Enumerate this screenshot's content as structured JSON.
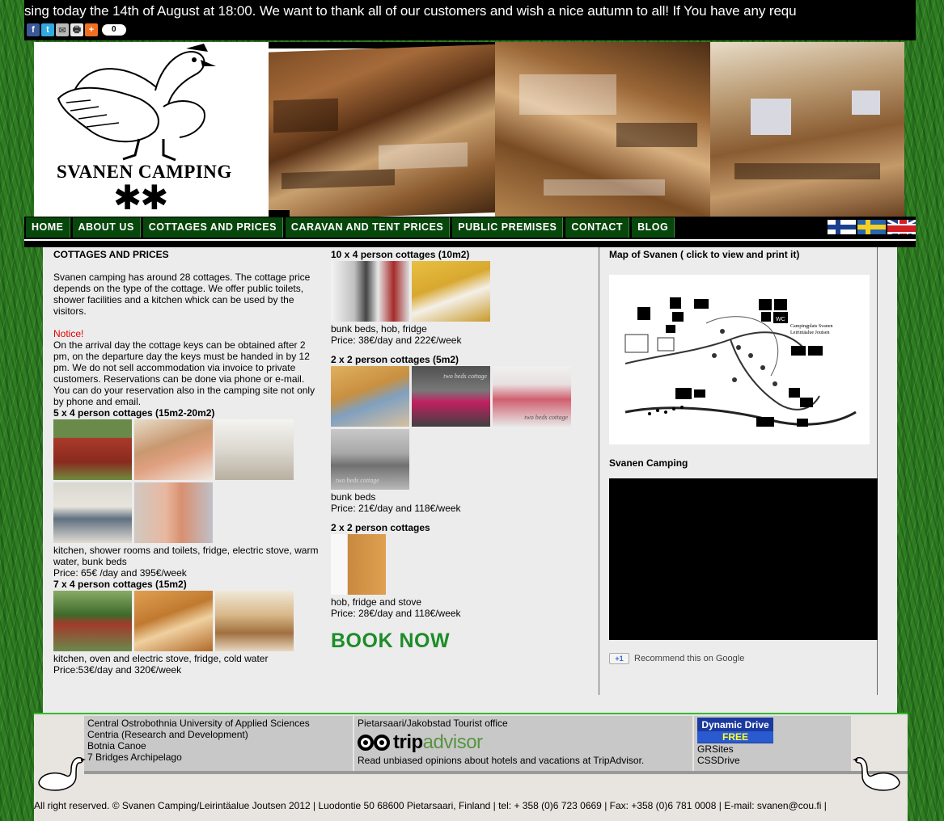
{
  "ticker": {
    "text": "sing today the 14th of August at 18:00. We want to thank all of our customers and wish a nice autumn to all! If You have any requ"
  },
  "share": {
    "facebook": "f",
    "twitter": "t",
    "email": "✉",
    "print": "🖶",
    "plus": "+",
    "count": "0"
  },
  "header": {
    "logo_text": "SVANEN CAMPING",
    "stars": "✱✱"
  },
  "nav": {
    "items": [
      {
        "label": "HOME"
      },
      {
        "label": "ABOUT US"
      },
      {
        "label": "COTTAGES AND PRICES"
      },
      {
        "label": "CARAVAN AND TENT PRICES"
      },
      {
        "label": "PUBLIC PREMISES"
      },
      {
        "label": "CONTACT"
      },
      {
        "label": "BLOG"
      }
    ],
    "flags": [
      "Finnish",
      "Swedish",
      "English"
    ]
  },
  "col1": {
    "title": "COTTAGES AND PRICES",
    "intro": "Svanen camping has around 28 cottages. The cottage price depends on the type of the cottage. We offer public toilets, shower facilities and a kitchen whick can be used by the visitors.",
    "notice_label": "Notice!",
    "notice_text": "On the arrival day the cottage keys can be obtained after 2 pm, on the departure day the keys must be handed in by 12 pm. We do not sell accommodation via invoice to private customers. Reservations can be done via phone or e-mail. You can do your reservation also in the camping site not only by phone and email.",
    "c5_title": "5 x 4 person cottages (15m2-20m2)",
    "c5_desc": "kitchen, shower rooms and toilets, fridge, electric stove, warm water, bunk beds",
    "c5_price": "Price: 65€ /day and 395€/week",
    "c7_title": "7 x 4 person cottages (15m2)",
    "c7_desc": "kitchen, oven and electric stove, fridge, cold water",
    "c7_price": "Price:53€/day and 320€/week"
  },
  "col2": {
    "c10_title": "10 x 4 person cottages (10m2)",
    "c10_desc": "bunk beds, hob, fridge",
    "c10_price": "Price: 38€/day and 222€/week",
    "c2a_title": "2 x 2 person cottages (5m2)",
    "c2a_overlay1": "two beds cottage",
    "c2a_overlay2": "two beds cottage",
    "c2a_overlay3": "two beds cottage",
    "c2a_desc": "bunk beds",
    "c2a_price": "Price: 21€/day and 118€/week",
    "c2b_title": "2 x 2 person cottages",
    "c2b_desc": "hob, fridge and stove",
    "c2b_price": "Price: 28€/day and 118€/week",
    "book_now": "BOOK NOW"
  },
  "col3": {
    "map_title": "Map of Svanen ( click to view and print it)",
    "map_label_1": "Campingplats Svanen",
    "map_label_2": "Leirintäalue Joutsen",
    "map_wc": "WC",
    "video_title": "Svanen Camping",
    "gplus_btn": "+1",
    "gplus_text": "Recommend this on Google"
  },
  "footer": {
    "links_1": [
      "Central Ostrobothnia University of Applied Sciences",
      "Centria (Research and Development)",
      "Botnia Canoe",
      "7 Bridges Archipelago"
    ],
    "tourist_office": "Pietarsaari/Jakobstad Tourist office",
    "trip_a": "trip",
    "trip_b": "advisor",
    "trip_caption": "Read unbiased opinions about hotels and vacations at TripAdvisor.",
    "dd_line1": "Dynamic Drive",
    "dd_free": "FREE",
    "links_3": [
      "GRSites",
      "CSSDrive"
    ],
    "copyright": "All right reserved. © Svanen Camping/Leirintäalue Joutsen 2012 | Luodontie 50 68600 Pietarsaari, Finland | tel: + 358 (0)6 723 0669 | Fax: +358 (0)6 781 0008 | E-mail: svanen@cou.fi |"
  }
}
